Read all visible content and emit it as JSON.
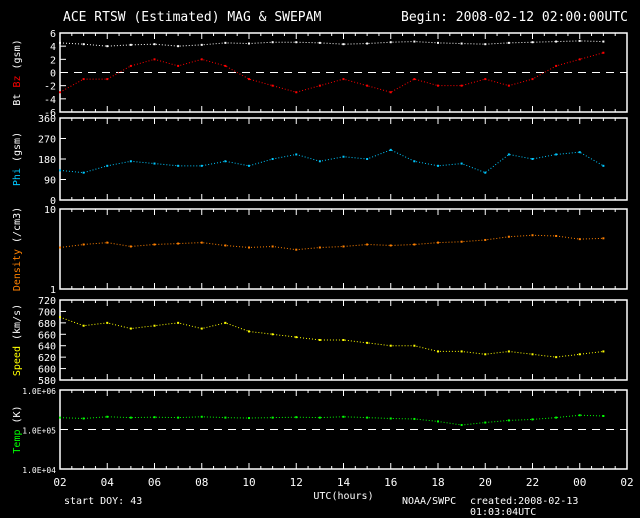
{
  "header": {
    "title": "ACE RTSW (Estimated) MAG & SWEPAM",
    "begin": "Begin: 2008-02-12 02:00:00UTC"
  },
  "footer": {
    "start_doy": "start DOY:  43",
    "source": "NOAA/SWPC",
    "created": "created:2008-02-13 01:03:04UTC"
  },
  "chart_data": [
    {
      "type": "scatter",
      "ylabel_parts": [
        "Bt",
        "Bz",
        "(gsm)"
      ],
      "colors": [
        "#ffffff",
        "#ff0000",
        "#ffffff"
      ],
      "ylim": [
        -6,
        6
      ],
      "yticks": [
        "6",
        "4",
        "2",
        "0",
        "-2",
        "-4",
        "-6"
      ],
      "dashed_zero": 0,
      "x": [
        2,
        3,
        4,
        5,
        6,
        7,
        8,
        9,
        10,
        11,
        12,
        13,
        14,
        15,
        16,
        17,
        18,
        19,
        20,
        21,
        22,
        23,
        24,
        25
      ],
      "series": [
        {
          "name": "Bt",
          "color": "#ffffff",
          "values": [
            4.5,
            4.3,
            4,
            4.2,
            4.3,
            4,
            4.2,
            4.5,
            4.4,
            4.6,
            4.6,
            4.5,
            4.3,
            4.4,
            4.6,
            4.7,
            4.5,
            4.4,
            4.3,
            4.5,
            4.6,
            4.7,
            4.8,
            4.7
          ]
        },
        {
          "name": "Bz",
          "color": "#ff0000",
          "values": [
            -3,
            -1,
            -1,
            1,
            2,
            1,
            2,
            1,
            -1,
            -2,
            -3,
            -2,
            -1,
            -2,
            -3,
            -1,
            -2,
            -2,
            -1,
            -2,
            -1,
            1,
            2,
            3
          ]
        }
      ]
    },
    {
      "type": "scatter",
      "ylabel_parts": [
        "Phi",
        "(gsm)"
      ],
      "colors": [
        "#00c8ff",
        "#ffffff"
      ],
      "ylim": [
        0,
        360
      ],
      "yticks": [
        "360",
        "270",
        "180",
        "90",
        "0"
      ],
      "x": [
        2,
        3,
        4,
        5,
        6,
        7,
        8,
        9,
        10,
        11,
        12,
        13,
        14,
        15,
        16,
        17,
        18,
        19,
        20,
        21,
        22,
        23,
        24,
        25
      ],
      "series": [
        {
          "color": "#00c8ff",
          "values": [
            130,
            120,
            150,
            170,
            160,
            150,
            150,
            170,
            150,
            180,
            200,
            170,
            190,
            180,
            220,
            170,
            150,
            160,
            120,
            200,
            180,
            200,
            210,
            150
          ]
        }
      ]
    },
    {
      "type": "scatter",
      "ylabel_parts": [
        "Density",
        "(/cm3)"
      ],
      "colors": [
        "#ff8000",
        "#ffffff"
      ],
      "ylim": [
        1,
        10
      ],
      "log": true,
      "yticks": [
        "10",
        "1"
      ],
      "x": [
        2,
        3,
        4,
        5,
        6,
        7,
        8,
        9,
        10,
        11,
        12,
        13,
        14,
        15,
        16,
        17,
        18,
        19,
        20,
        21,
        22,
        23,
        24,
        25
      ],
      "series": [
        {
          "color": "#ff8000",
          "values": [
            3.3,
            3.6,
            3.8,
            3.4,
            3.6,
            3.7,
            3.8,
            3.5,
            3.3,
            3.4,
            3.1,
            3.3,
            3.4,
            3.6,
            3.5,
            3.6,
            3.8,
            3.9,
            4.1,
            4.5,
            4.7,
            4.6,
            4.2,
            4.3
          ]
        }
      ]
    },
    {
      "type": "scatter",
      "ylabel_parts": [
        "Speed",
        "(km/s)"
      ],
      "colors": [
        "#ffff00",
        "#ffffff"
      ],
      "ylim": [
        580,
        720
      ],
      "yticks": [
        "720",
        "700",
        "680",
        "660",
        "640",
        "620",
        "600",
        "580"
      ],
      "x": [
        2,
        3,
        4,
        5,
        6,
        7,
        8,
        9,
        10,
        11,
        12,
        13,
        14,
        15,
        16,
        17,
        18,
        19,
        20,
        21,
        22,
        23,
        24,
        25
      ],
      "series": [
        {
          "color": "#ffff00",
          "values": [
            690,
            675,
            680,
            670,
            675,
            680,
            670,
            680,
            665,
            660,
            655,
            650,
            650,
            645,
            640,
            640,
            630,
            630,
            625,
            630,
            625,
            620,
            625,
            630
          ]
        }
      ]
    },
    {
      "type": "scatter",
      "ylabel_parts": [
        "Temp",
        "(K)"
      ],
      "colors": [
        "#00ff00",
        "#ffffff"
      ],
      "ylim": [
        10000,
        1000000
      ],
      "log": true,
      "yticks": [
        "1.0E+06",
        "1.0E+05",
        "1.0E+04"
      ],
      "dashed_at": 100000,
      "x": [
        2,
        3,
        4,
        5,
        6,
        7,
        8,
        9,
        10,
        11,
        12,
        13,
        14,
        15,
        16,
        17,
        18,
        19,
        20,
        21,
        22,
        23,
        24,
        25
      ],
      "series": [
        {
          "color": "#00ff00",
          "values": [
            200000,
            190000,
            210000,
            200000,
            205000,
            200000,
            210000,
            200000,
            195000,
            200000,
            205000,
            200000,
            210000,
            200000,
            190000,
            185000,
            160000,
            130000,
            150000,
            170000,
            180000,
            200000,
            230000,
            220000
          ]
        }
      ]
    }
  ],
  "xaxis": {
    "label": "UTC(hours)",
    "ticks": [
      "02",
      "04",
      "06",
      "08",
      "10",
      "12",
      "14",
      "16",
      "18",
      "20",
      "22",
      "00",
      "02"
    ],
    "xlim": [
      2,
      26
    ]
  }
}
